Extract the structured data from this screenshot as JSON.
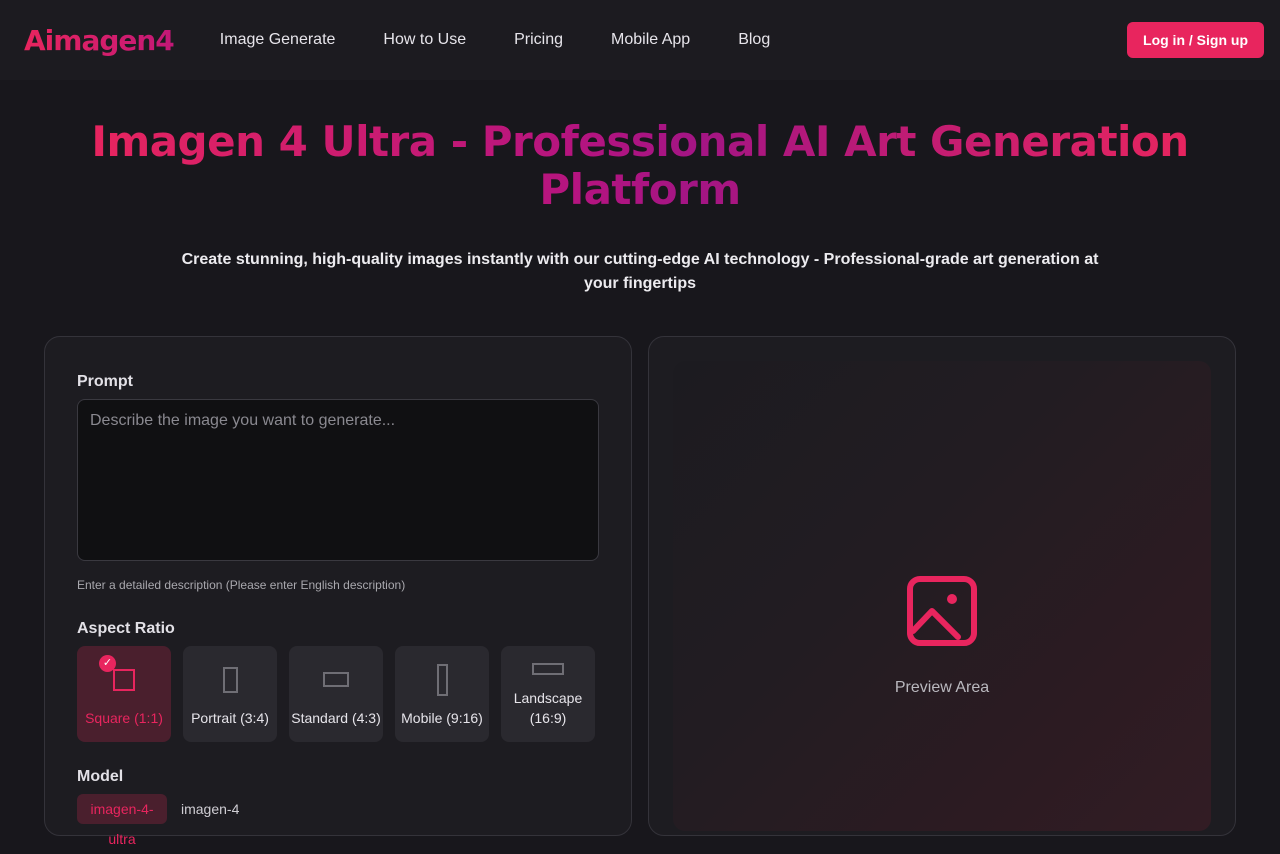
{
  "nav": {
    "brand": "Aimagen4",
    "links": [
      "Image Generate",
      "How to Use",
      "Pricing",
      "Mobile App",
      "Blog"
    ],
    "login_label": "Log in / Sign up"
  },
  "hero": {
    "title": "Imagen 4 Ultra - Professional AI Art Generation Platform",
    "subtitle": "Create stunning, high-quality images instantly with our cutting-edge AI technology - Professional-grade art generation at your fingertips"
  },
  "form": {
    "prompt_label": "Prompt",
    "prompt_placeholder": "Describe the image you want to generate...",
    "prompt_value": "",
    "prompt_hint": "Enter a detailed description (Please enter English description)",
    "aspect_label": "Aspect Ratio",
    "aspect_ratios": [
      {
        "label": "Square (1:1)",
        "selected": true
      },
      {
        "label": "Portrait (3:4)",
        "selected": false
      },
      {
        "label": "Standard (4:3)",
        "selected": false
      },
      {
        "label": "Mobile (9:16)",
        "selected": false
      },
      {
        "label": "Landscape (16:9)",
        "selected": false
      }
    ],
    "model_label": "Model",
    "model_selected": "imagen-4-ultra",
    "model_next": "imagen-4"
  },
  "preview": {
    "label": "Preview Area",
    "icon": "image-icon"
  },
  "colors": {
    "accent": "#e8255e",
    "accent_dark": "#b41480",
    "background": "#18171c",
    "card": "#1d1c21"
  }
}
